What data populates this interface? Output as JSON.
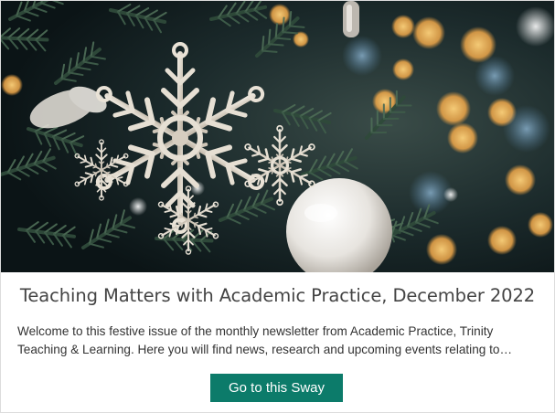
{
  "card": {
    "image_alt": "Glittering silver snowflake ornament on a Christmas tree with bokeh lights",
    "title": "Teaching Matters with Academic Practice, December 2022",
    "description": "Welcome to this festive issue of the monthly newsletter from Academic Practice, Trinity Teaching & Learning. Here you will find news, research and upcoming events relating to teaching, lear...",
    "button_label": "Go to this Sway"
  },
  "colors": {
    "accent": "#0c7b6a",
    "title_text": "#444444",
    "body_text": "#333333"
  }
}
